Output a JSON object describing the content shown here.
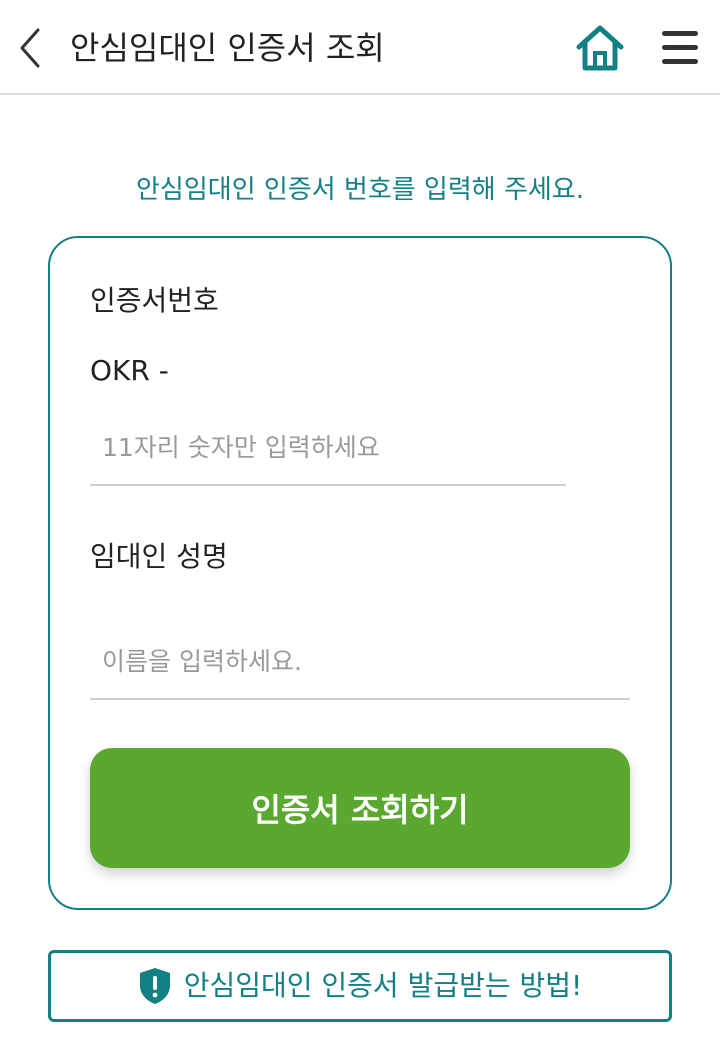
{
  "header": {
    "title": "안심임대인 인증서 조회",
    "back_icon": "chevron-left-icon",
    "home_icon": "home-icon",
    "menu_icon": "hamburger-menu-icon"
  },
  "main": {
    "prompt": "안심임대인 인증서 번호를 입력해 주세요.",
    "cert_number": {
      "label": "인증서번호",
      "prefix": "OKR -",
      "placeholder": "11자리 숫자만 입력하세요",
      "value": ""
    },
    "landlord_name": {
      "label": "임대인 성명",
      "placeholder": "이름을 입력하세요.",
      "value": ""
    },
    "submit_label": "인증서 조회하기"
  },
  "guide": {
    "label": "안심임대인 인증서 발급받는 방법!",
    "icon": "shield-alert-icon"
  },
  "colors": {
    "accent": "#138086",
    "button": "#5aa830",
    "divider": "#dcdcdc"
  }
}
